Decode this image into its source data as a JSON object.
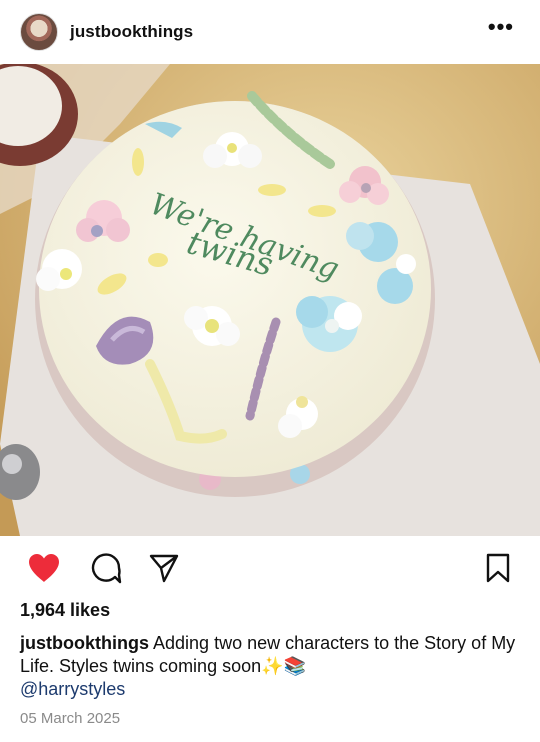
{
  "post": {
    "username": "justbookthings",
    "more_label": "•••",
    "likes": "1,964 likes",
    "caption_user": "justbookthings",
    "caption_text": "Adding two new characters to the Story of My Life. Styles twins coming soon✨📚",
    "mention": "@harrystyles",
    "date": "05 March 2025",
    "cake_text_line1": "We're having",
    "cake_text_line2": "twins"
  },
  "icons": {
    "like": "heart-icon",
    "comment": "comment-icon",
    "share": "send-icon",
    "save": "bookmark-icon"
  },
  "colors": {
    "heart": "#ed2c3a",
    "mention": "#1d3b6e",
    "date": "#8a8a8a",
    "cake_text": "#4f8a5f"
  }
}
